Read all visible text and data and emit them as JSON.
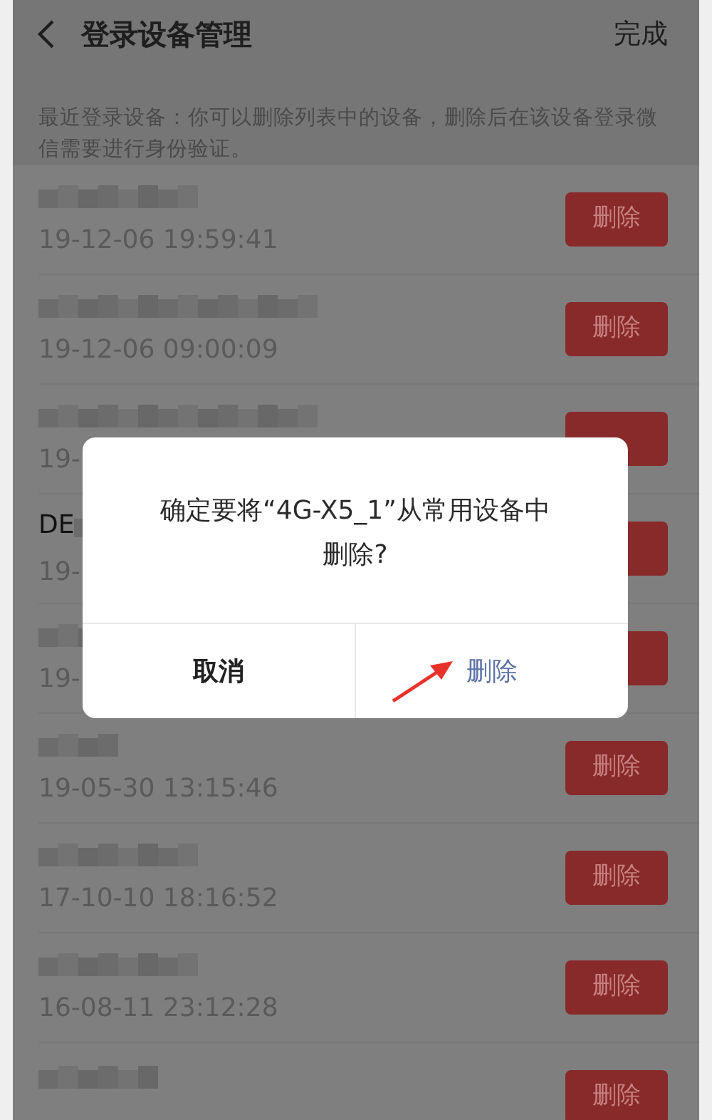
{
  "header": {
    "title": "登录设备管理",
    "done": "完成"
  },
  "description": "最近登录设备：你可以删除列表中的设备，删除后在该设备登录微信需要进行身份验证。",
  "devices": [
    {
      "time": "19-12-06 19:59:41",
      "action": "删除"
    },
    {
      "time": "19-12-06 09:00:09",
      "action": "删除"
    },
    {
      "time": "19-"
    },
    {
      "name_prefix": "DE",
      "time": "19-"
    },
    {
      "time": "19-"
    },
    {
      "time": "19-05-30 13:15:46",
      "action": "删除"
    },
    {
      "time": "17-10-10 18:16:52",
      "action": "删除"
    },
    {
      "time": "16-08-11 23:12:28",
      "action": "删除"
    },
    {
      "action": "删除"
    }
  ],
  "dialog": {
    "message": "确定要将“4G-X5_1”从常用设备中删除?",
    "cancel": "取消",
    "confirm": "删除"
  }
}
